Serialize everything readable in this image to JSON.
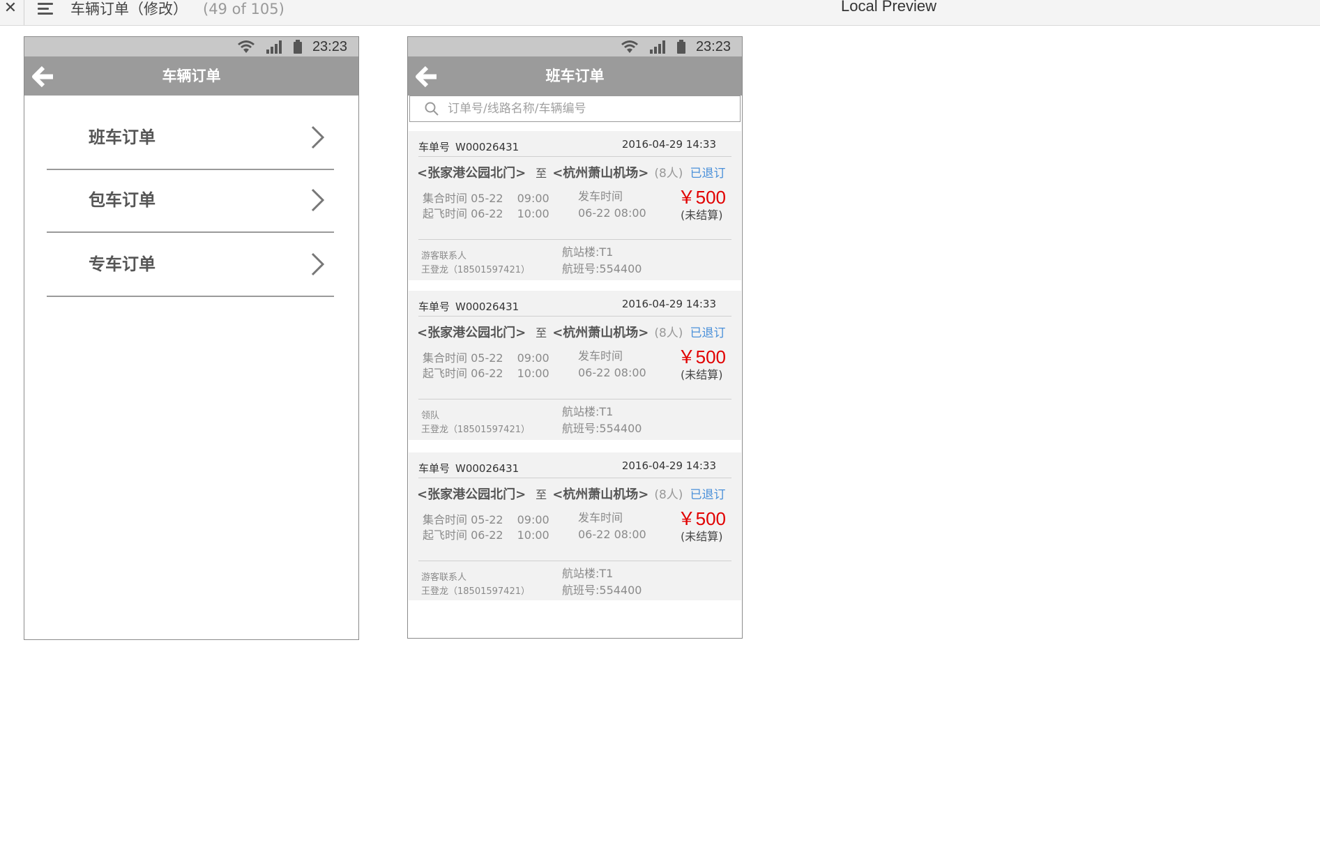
{
  "topbar": {
    "title": "车辆订单（修改）",
    "count": "(49 of 105)",
    "preview": "Local Preview"
  },
  "phone1": {
    "time": "23:23",
    "nav_title": "车辆订单",
    "items": [
      {
        "label": "班车订单"
      },
      {
        "label": "包车订单"
      },
      {
        "label": "专车订单"
      }
    ]
  },
  "phone2": {
    "time": "23:23",
    "nav_title": "班车订单",
    "search_placeholder": "订单号/线路名称/车辆编号",
    "orders": [
      {
        "no_label": "车单号",
        "no": "W00026431",
        "datetime": "2016-04-29  14:33",
        "from": "<张家港公园北门>",
        "to_word": "至",
        "dest": "<杭州萧山机场>",
        "pax": "(8人)",
        "status": "已退订",
        "gather": "集合时间 05-22",
        "gather_t": "09:00",
        "takeoff": "起飞时间 06-22",
        "takeoff_t": "10:00",
        "dep_label": "发车时间",
        "dep_time": "06-22  08:00",
        "price": "￥500",
        "settle": "(未结算)",
        "role": "游客联系人",
        "person": "王登龙（18501597421）",
        "terminal": "航站楼:T1",
        "flight": "航班号:554400"
      },
      {
        "no_label": "车单号",
        "no": "W00026431",
        "datetime": "2016-04-29  14:33",
        "from": "<张家港公园北门>",
        "to_word": "至",
        "dest": "<杭州萧山机场>",
        "pax": "(8人)",
        "status": "已退订",
        "gather": "集合时间 05-22",
        "gather_t": "09:00",
        "takeoff": "起飞时间 06-22",
        "takeoff_t": "10:00",
        "dep_label": "发车时间",
        "dep_time": "06-22  08:00",
        "price": "￥500",
        "settle": "(未结算)",
        "role": "领队",
        "person": "王登龙（18501597421）",
        "terminal": "航站楼:T1",
        "flight": "航班号:554400"
      },
      {
        "no_label": "车单号",
        "no": "W00026431",
        "datetime": "2016-04-29  14:33",
        "from": "<张家港公园北门>",
        "to_word": "至",
        "dest": "<杭州萧山机场>",
        "pax": "(8人)",
        "status": "已退订",
        "gather": "集合时间 05-22",
        "gather_t": "09:00",
        "takeoff": "起飞时间 06-22",
        "takeoff_t": "10:00",
        "dep_label": "发车时间",
        "dep_time": "06-22  08:00",
        "price": "￥500",
        "settle": "(未结算)",
        "role": "游客联系人",
        "person": "王登龙（18501597421）",
        "terminal": "航站楼:T1",
        "flight": "航班号:554400"
      }
    ]
  },
  "colors": {
    "navbar": "#9b9b9b",
    "statusbar": "#c8c8c8",
    "price": "#e10000",
    "status_link": "#4a90d9",
    "card_bg": "#f2f2f2"
  }
}
